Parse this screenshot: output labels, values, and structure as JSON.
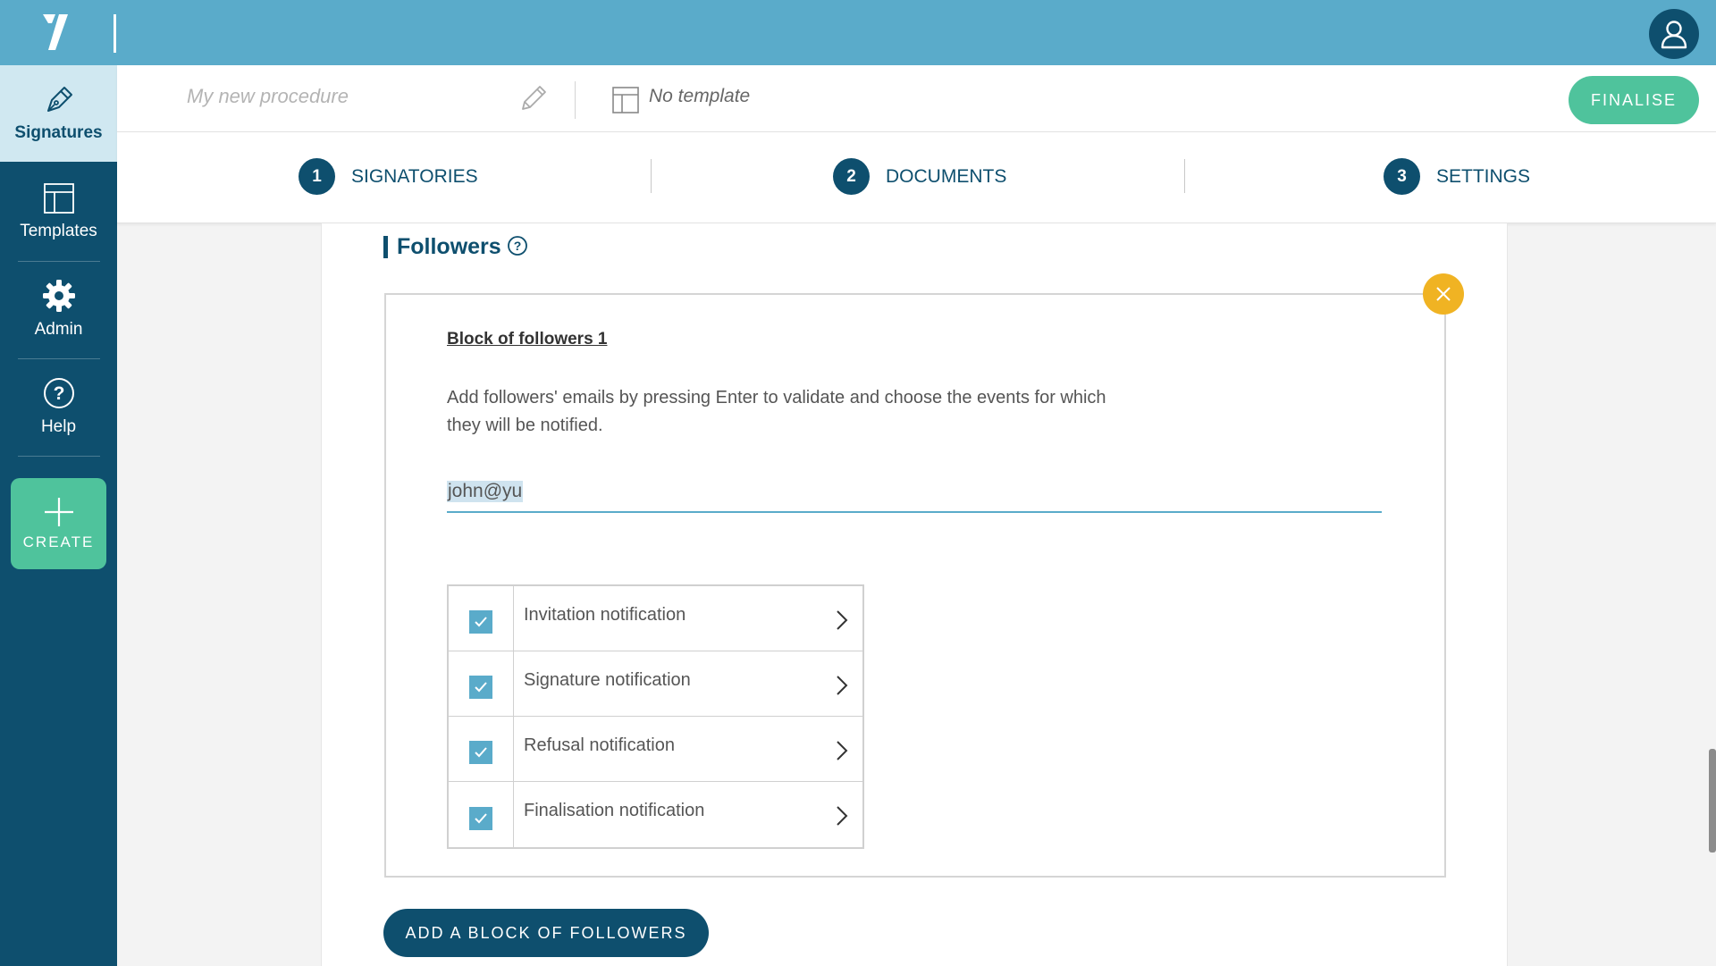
{
  "app": {
    "colors": {
      "primary": "#0e4f6e",
      "topbar": "#5aabca",
      "accent": "#4fc39c",
      "warning": "#f0b323"
    }
  },
  "sidebar": {
    "items": [
      {
        "label": "Signatures",
        "icon": "pen-nib-icon",
        "active": true
      },
      {
        "label": "Templates",
        "icon": "template-icon",
        "active": false
      },
      {
        "label": "Admin",
        "icon": "gear-icon",
        "active": false
      },
      {
        "label": "Help",
        "icon": "question-circle-icon",
        "active": false
      }
    ],
    "create_label": "CREATE"
  },
  "procedure": {
    "name_placeholder": "My new procedure",
    "template_label": "No template",
    "finalise_label": "FINALISE"
  },
  "steps": [
    {
      "number": "1",
      "label": "SIGNATORIES"
    },
    {
      "number": "2",
      "label": "DOCUMENTS"
    },
    {
      "number": "3",
      "label": "SETTINGS"
    }
  ],
  "followers": {
    "title": "Followers",
    "block_title": "Block of followers 1",
    "description": "Add followers' emails by pressing Enter to validate and choose the events for which they will be notified.",
    "email_value": "john@yu",
    "notifications": [
      {
        "label": "Invitation notification",
        "checked": true
      },
      {
        "label": "Signature notification",
        "checked": true
      },
      {
        "label": "Refusal notification",
        "checked": true
      },
      {
        "label": "Finalisation notification",
        "checked": true
      }
    ],
    "add_block_label": "ADD A BLOCK OF FOLLOWERS"
  }
}
